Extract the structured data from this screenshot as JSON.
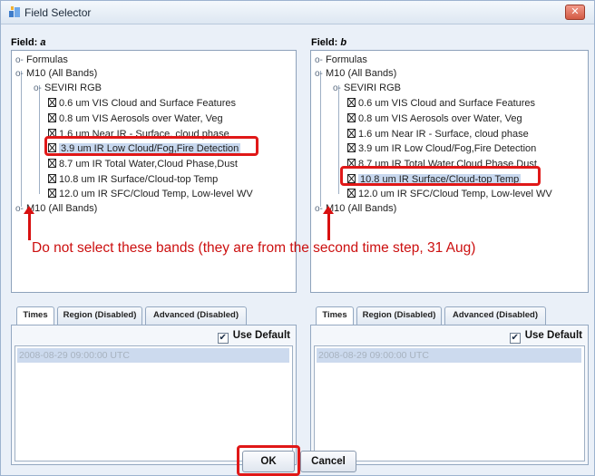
{
  "window": {
    "title": "Field Selector",
    "close_label": "✕"
  },
  "left": {
    "field_label": "Field:",
    "field_var": "a",
    "tree": {
      "formulas": "Formulas",
      "m10_first": "M10 (All Bands)",
      "group": "SEVIRI RGB",
      "bands": [
        "0.6 um VIS Cloud and Surface Features",
        "0.8 um VIS Aerosols over Water, Veg",
        "1.6 um Near IR - Surface, cloud phase",
        "3.9 um IR Low Cloud/Fog,Fire Detection",
        "8.7 um IR Total Water,Cloud Phase,Dust",
        "10.8 um IR Surface/Cloud-top Temp",
        "12.0 um IR SFC/Cloud Temp, Low-level WV"
      ],
      "m10_second": "M10 (All Bands)",
      "selected_index": 3
    },
    "tabs": [
      "Times",
      "Region (Disabled)",
      "Advanced (Disabled)"
    ],
    "active_tab": "Times",
    "use_default": "Use Default",
    "use_default_checked": true,
    "time_value": "2008-08-29 09:00:00 UTC"
  },
  "right": {
    "field_label": "Field:",
    "field_var": "b",
    "tree": {
      "formulas": "Formulas",
      "m10_first": "M10 (All Bands)",
      "group": "SEVIRI RGB",
      "bands": [
        "0.6 um VIS Cloud and Surface Features",
        "0.8 um VIS Aerosols over Water, Veg",
        "1.6 um Near IR - Surface, cloud phase",
        "3.9 um IR Low Cloud/Fog,Fire Detection",
        "8.7 um IR Total Water,Cloud Phase,Dust",
        "10.8 um IR Surface/Cloud-top Temp",
        "12.0 um IR SFC/Cloud Temp, Low-level WV"
      ],
      "m10_second": "M10 (All Bands)",
      "selected_index": 5
    },
    "tabs": [
      "Times",
      "Region (Disabled)",
      "Advanced (Disabled)"
    ],
    "active_tab": "Times",
    "use_default": "Use Default",
    "use_default_checked": true,
    "time_value": "2008-08-29 09:00:00 UTC"
  },
  "annotation": "Do not select these bands (they are from the second time step, 31 Aug)",
  "buttons": {
    "ok": "OK",
    "cancel": "Cancel"
  },
  "colors": {
    "annotation_red": "#cc1010",
    "selection": "#c8d8ef",
    "window_bg": "#eaf0f8"
  },
  "icons": {
    "app": "field-selector-app-icon",
    "expand": "tree-expand-handle-icon",
    "leaf": "band-leaf-icon",
    "check": "checkbox-check-icon"
  }
}
